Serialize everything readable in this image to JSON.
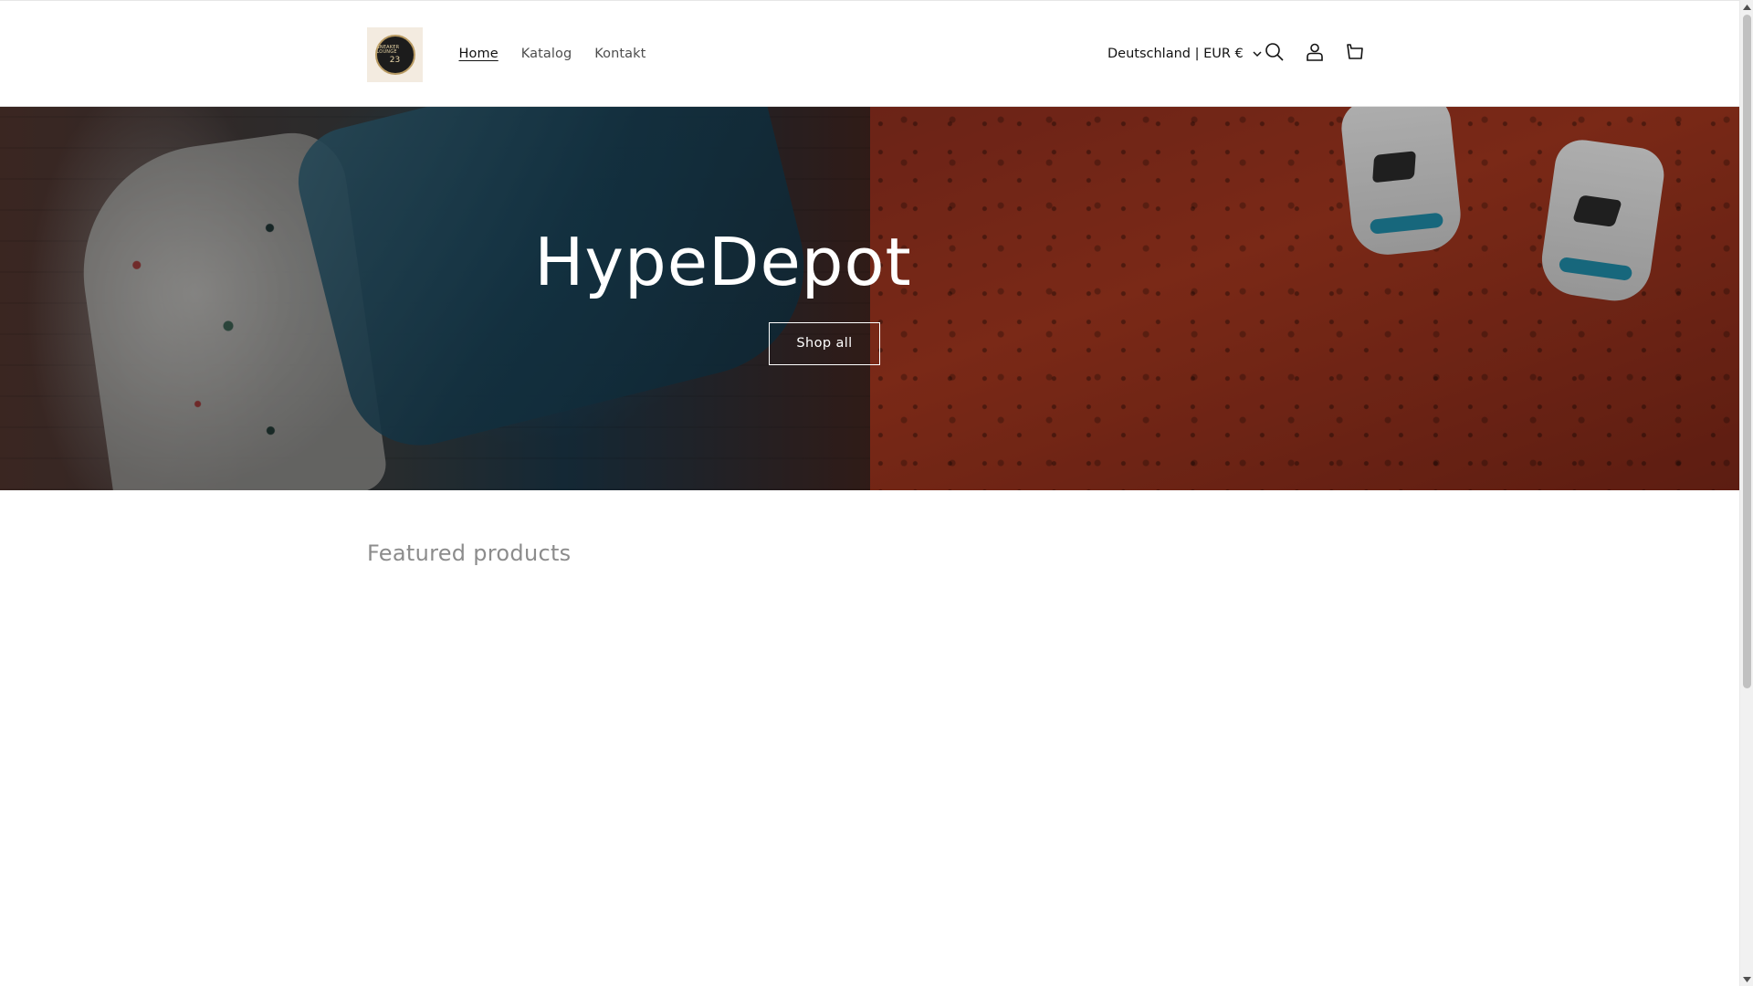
{
  "header": {
    "logo_alt": "Sneaker Lounge 23",
    "logo_text_top": "SNEAKER LOUNGE",
    "logo_text_num": "23",
    "nav": [
      {
        "label": "Home",
        "active": true
      },
      {
        "label": "Katalog",
        "active": false
      },
      {
        "label": "Kontakt",
        "active": false
      }
    ],
    "locale_label": "Deutschland | EUR €",
    "icons": [
      "search-icon",
      "account-icon",
      "cart-icon"
    ]
  },
  "hero": {
    "title": "HypeDepot",
    "button_label": "Shop all"
  },
  "featured": {
    "title": "Featured products"
  },
  "colors": {
    "text": "#121212",
    "muted_text": "#4d4d4d",
    "heading_gray": "#8c8c8c",
    "hero_right_red": "#a3371f",
    "accent_teal": "#1f8aa6"
  }
}
